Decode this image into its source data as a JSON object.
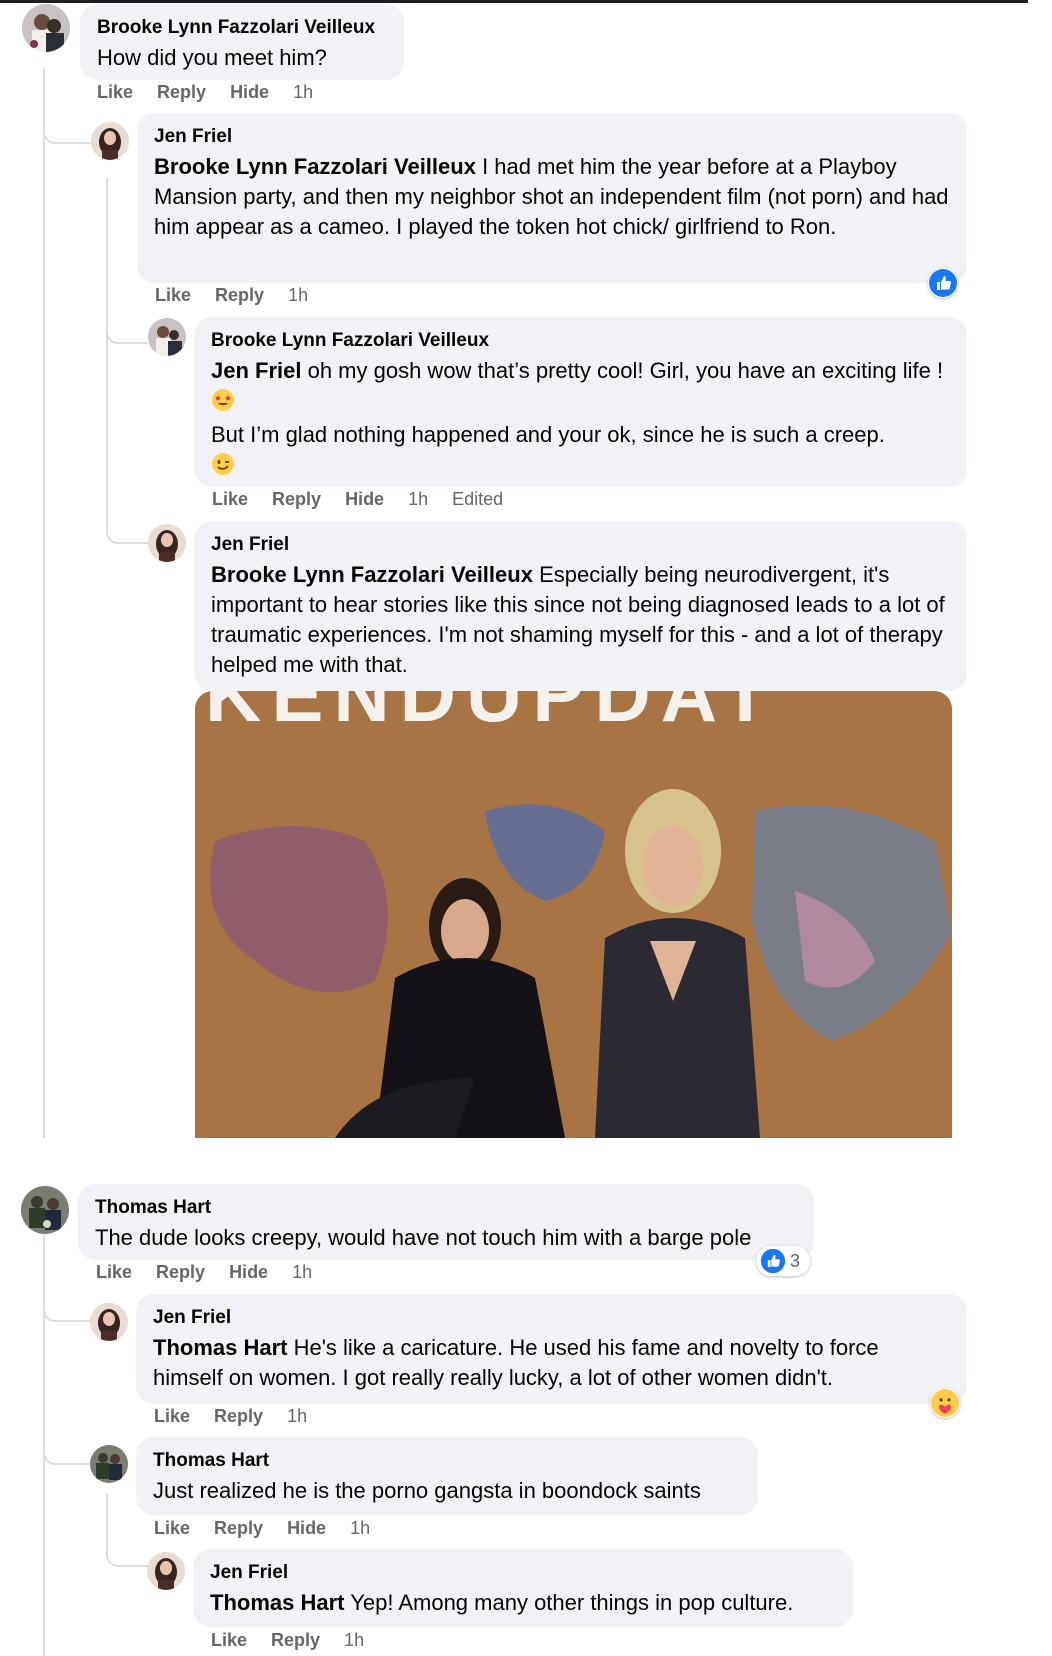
{
  "colors": {
    "bubble": "#f0f2f5",
    "link_blue": "#1877f2",
    "meta_gray": "#65676b"
  },
  "comments": [
    {
      "author": "Brooke Lynn Fazzolari Veilleux",
      "text": "How did you meet him?",
      "actions": {
        "like": "Like",
        "reply": "Reply",
        "hide": "Hide",
        "time": "1h"
      }
    },
    {
      "author": "Jen Friel",
      "tag": "Brooke Lynn Fazzolari Veilleux",
      "text": " I had met him the year before at a Playboy Mansion party, and then my neighbor shot an independent film (not porn) and had him appear as a cameo. I played the token hot chick/ girlfriend to Ron.",
      "actions": {
        "like": "Like",
        "reply": "Reply",
        "time": "1h"
      },
      "reaction_icon": "like-reaction-icon"
    },
    {
      "author": "Brooke Lynn Fazzolari Veilleux",
      "tag": "Jen Friel",
      "text_line1": " oh my gosh wow    that’s pretty cool!    Girl, you have an exciting life   !",
      "text_line2": "But I’m glad nothing happened and your ok, since he is such a creep.",
      "emoji1": "star-struck-emoji",
      "emoji2": "winking-face-emoji",
      "actions": {
        "like": "Like",
        "reply": "Reply",
        "hide": "Hide",
        "time": "1h",
        "edited": "Edited"
      }
    },
    {
      "author": "Jen Friel",
      "tag": "Brooke Lynn Fazzolari Veilleux",
      "text": " Especially being neurodivergent, it's important to hear stories like this since not being diagnosed leads to a lot of traumatic experiences. I'm not shaming myself for this - and a lot of therapy helped me with that."
    },
    {
      "author": "Thomas Hart",
      "text": "The dude looks creepy, would have not touch him with a barge pole",
      "actions": {
        "like": "Like",
        "reply": "Reply",
        "hide": "Hide",
        "time": "1h"
      },
      "reaction_count": "3"
    },
    {
      "author": "Jen Friel",
      "tag": "Thomas Hart",
      "text": " He's like a caricature. He used his fame and novelty to force himself on women. I got really really lucky, a lot of other women didn't.",
      "actions": {
        "like": "Like",
        "reply": "Reply",
        "time": "1h"
      },
      "reaction_icon": "care-reaction-icon"
    },
    {
      "author": "Thomas Hart",
      "text": "Just realized he is the porno gangsta in boondock saints",
      "actions": {
        "like": "Like",
        "reply": "Reply",
        "hide": "Hide",
        "time": "1h"
      }
    },
    {
      "author": "Jen Friel",
      "tag": "Thomas Hart",
      "text": " Yep! Among many other things in pop culture.",
      "actions": {
        "like": "Like",
        "reply": "Reply",
        "time": "1h"
      }
    }
  ],
  "gif": {
    "banner_text": "KENDUPDAT"
  }
}
